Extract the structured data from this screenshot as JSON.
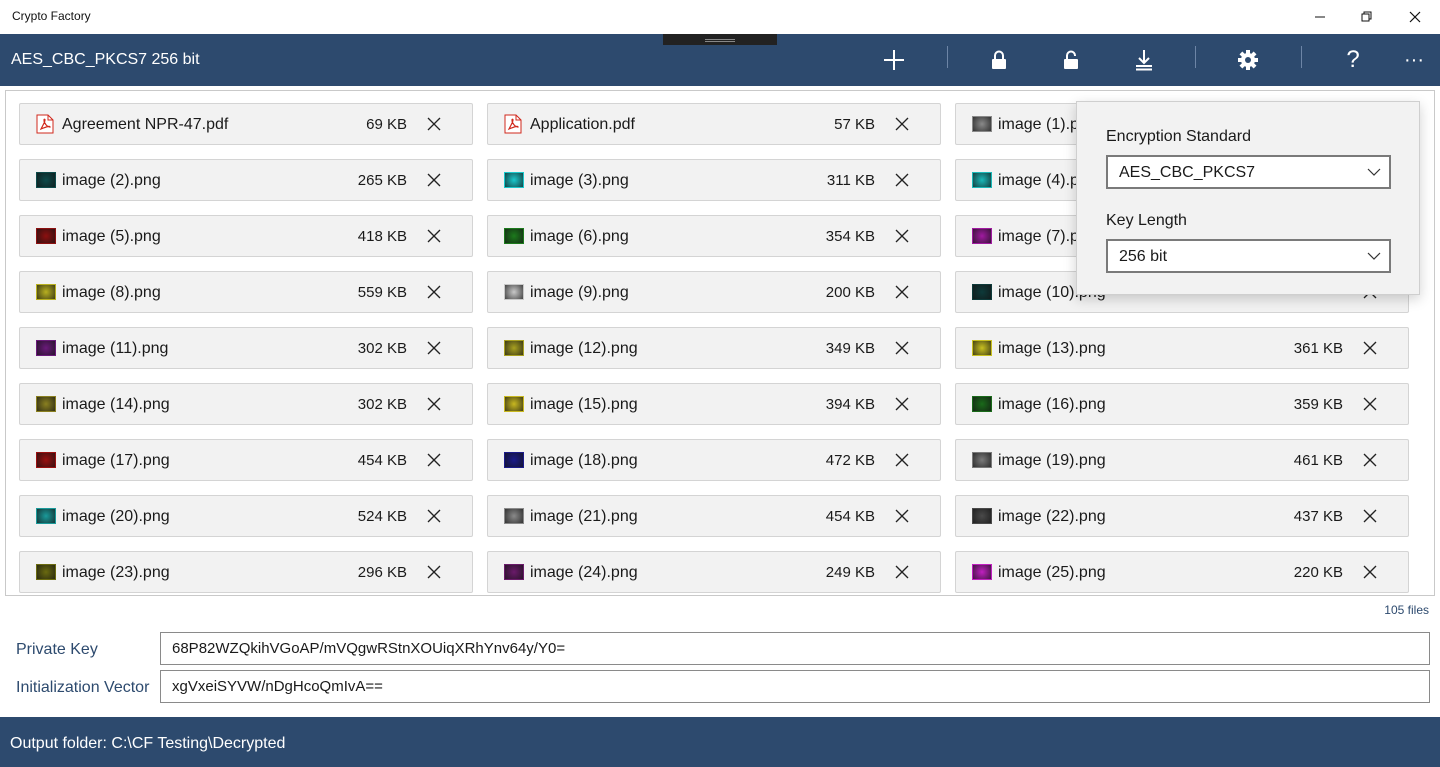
{
  "window": {
    "title": "Crypto Factory"
  },
  "commandbar": {
    "mode": "AES_CBC_PKCS7 256 bit",
    "buttons": [
      {
        "icon": "add-icon"
      },
      {
        "icon": "lock-icon"
      },
      {
        "icon": "unlock-icon"
      },
      {
        "icon": "download-icon"
      },
      {
        "icon": "gear-icon"
      },
      {
        "icon": "help-icon",
        "glyph": "?"
      },
      {
        "icon": "more-icon",
        "glyph": "···"
      }
    ]
  },
  "files": [
    {
      "name": "Agreement NPR-47.pdf",
      "size": "69 KB",
      "type": "pdf"
    },
    {
      "name": "Application.pdf",
      "size": "57 KB",
      "type": "pdf"
    },
    {
      "name": "image (1).png",
      "size": "",
      "type": "png",
      "color": "#8a8a8a"
    },
    {
      "name": "image (2).png",
      "size": "265 KB",
      "type": "png",
      "color": "#0d4a4a"
    },
    {
      "name": "image (3).png",
      "size": "311 KB",
      "type": "png",
      "color": "#19c8cc"
    },
    {
      "name": "image (4).png",
      "size": "",
      "type": "png",
      "color": "#1ab8b8"
    },
    {
      "name": "image (5).png",
      "size": "418 KB",
      "type": "png",
      "color": "#8c1010"
    },
    {
      "name": "image (6).png",
      "size": "354 KB",
      "type": "png",
      "color": "#1c7a1c"
    },
    {
      "name": "image (7).png",
      "size": "",
      "type": "png",
      "color": "#a01aa0"
    },
    {
      "name": "image (8).png",
      "size": "559 KB",
      "type": "png",
      "color": "#b8b020"
    },
    {
      "name": "image (9).png",
      "size": "200 KB",
      "type": "png",
      "color": "#c8c8c8"
    },
    {
      "name": "image (10).png",
      "size": "",
      "type": "png",
      "color": "#0e3a3a"
    },
    {
      "name": "image (11).png",
      "size": "302 KB",
      "type": "png",
      "color": "#6a1a7a"
    },
    {
      "name": "image (12).png",
      "size": "349 KB",
      "type": "png",
      "color": "#a8a020"
    },
    {
      "name": "image (13).png",
      "size": "361 KB",
      "type": "png",
      "color": "#c8c020"
    },
    {
      "name": "image (14).png",
      "size": "302 KB",
      "type": "png",
      "color": "#8a8020"
    },
    {
      "name": "image (15).png",
      "size": "394 KB",
      "type": "png",
      "color": "#c8b820"
    },
    {
      "name": "image (16).png",
      "size": "359 KB",
      "type": "png",
      "color": "#1a6a1a"
    },
    {
      "name": "image (17).png",
      "size": "454 KB",
      "type": "png",
      "color": "#9a1010"
    },
    {
      "name": "image (18).png",
      "size": "472 KB",
      "type": "png",
      "color": "#1a1a8a"
    },
    {
      "name": "image (19).png",
      "size": "461 KB",
      "type": "png",
      "color": "#7a7a7a"
    },
    {
      "name": "image (20).png",
      "size": "524 KB",
      "type": "png",
      "color": "#1a9a9a"
    },
    {
      "name": "image (21).png",
      "size": "454 KB",
      "type": "png",
      "color": "#8a8a8a"
    },
    {
      "name": "image (22).png",
      "size": "437 KB",
      "type": "png",
      "color": "#4a4a4a"
    },
    {
      "name": "image (23).png",
      "size": "296 KB",
      "type": "png",
      "color": "#6a6a10"
    },
    {
      "name": "image (24).png",
      "size": "249 KB",
      "type": "png",
      "color": "#6a1a6a"
    },
    {
      "name": "image (25).png",
      "size": "220 KB",
      "type": "png",
      "color": "#c020c0"
    }
  ],
  "file_count": "105 files",
  "settings": {
    "standard_label": "Encryption Standard",
    "standard_value": "AES_CBC_PKCS7",
    "keylength_label": "Key Length",
    "keylength_value": "256 bit"
  },
  "keys": {
    "private_key_label": "Private Key",
    "private_key_value": "68P82WZQkihVGoAP/mVQgwRStnXOUiqXRhYnv64y/Y0=",
    "iv_label": "Initialization Vector",
    "iv_value": "xgVxeiSYVW/nDgHcoQmIvA=="
  },
  "status": {
    "output_folder": "Output folder: C:\\CF Testing\\Decrypted"
  },
  "colors": {
    "accent": "#2d4a6e",
    "tile": "#f2f2f2",
    "pdf_red": "#d0281c"
  }
}
